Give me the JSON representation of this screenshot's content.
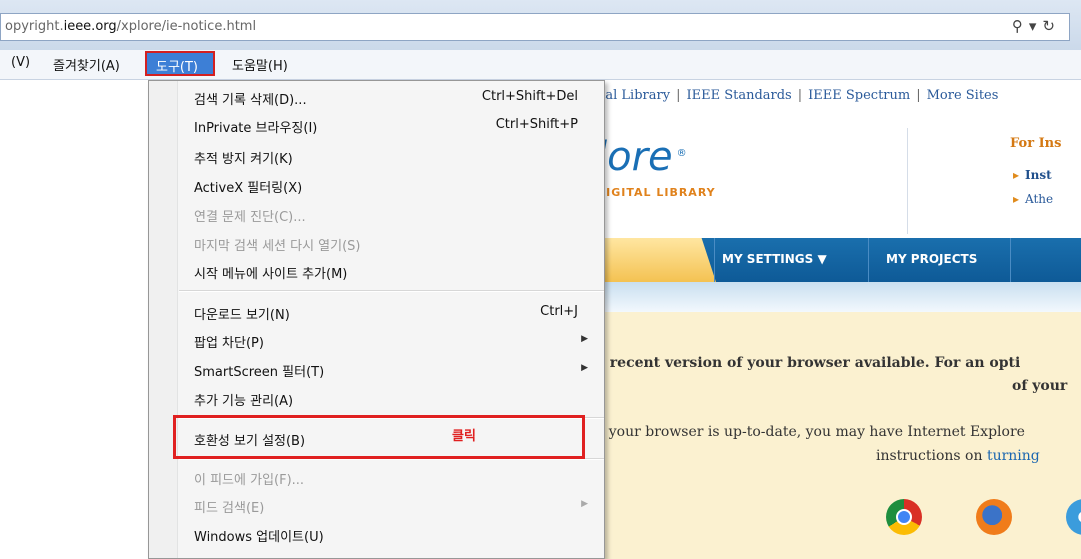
{
  "address_bar": {
    "url_prefix": "opyright.",
    "url_domain": "ieee.org",
    "url_path": "/xplore/ie-notice.html",
    "icons": [
      "search-icon",
      "refresh-icon"
    ]
  },
  "menu_bar": {
    "view": "(V)",
    "favorites": "즐겨찾기(A)",
    "tools": "도구(T)",
    "help": "도움말(H)"
  },
  "page": {
    "sites_links": [
      "ital Library",
      "IEEE Standards",
      "IEEE Spectrum",
      "More Sites"
    ],
    "logo": "lore",
    "logo_mark": "®",
    "logo_sub": "DIGITAL LIBRARY",
    "institution_title": "For Ins",
    "institution_links": [
      "Inst",
      "Athe"
    ],
    "nav": {
      "settings": "MY SETTINGS ▼",
      "projects": "MY PROJECTS"
    },
    "notice_line1a": "e recent version of your browser available. For an opti",
    "notice_line1b": "of your",
    "notice_line2a": "e your browser is up-to-date, you may have Internet Explore",
    "notice_line2b_prefix": "instructions on ",
    "notice_line2b_link": "turning"
  },
  "tools_menu": {
    "items": [
      {
        "label": "검색 기록 삭제(D)...",
        "shortcut": "Ctrl+Shift+Del"
      },
      {
        "label": "InPrivate 브라우징(I)",
        "shortcut": "Ctrl+Shift+P"
      },
      {
        "label": "추적 방지 켜기(K)"
      },
      {
        "label": "ActiveX 필터링(X)"
      },
      {
        "label": "연결 문제 진단(C)..."
      },
      {
        "label": "마지막 검색 세션 다시 열기(S)"
      },
      {
        "label": "시작 메뉴에 사이트 추가(M)"
      },
      {
        "label": "다운로드 보기(N)",
        "shortcut": "Ctrl+J"
      },
      {
        "label": "팝업 차단(P)"
      },
      {
        "label": "SmartScreen 필터(T)"
      },
      {
        "label": "추가 기능 관리(A)"
      },
      {
        "label": "호환성 보기 설정(B)"
      },
      {
        "label": "이 피드에 가입(F)..."
      },
      {
        "label": "피드 검색(E)"
      },
      {
        "label": "Windows 업데이트(U)"
      }
    ],
    "annotation": "클릭"
  },
  "colors": {
    "highlight_border": "#e02020",
    "menu_selected": "#3d7fd6",
    "nav_bar": "#1a6fad",
    "logo": "#1a6fb5",
    "accent_orange": "#e0821c"
  }
}
